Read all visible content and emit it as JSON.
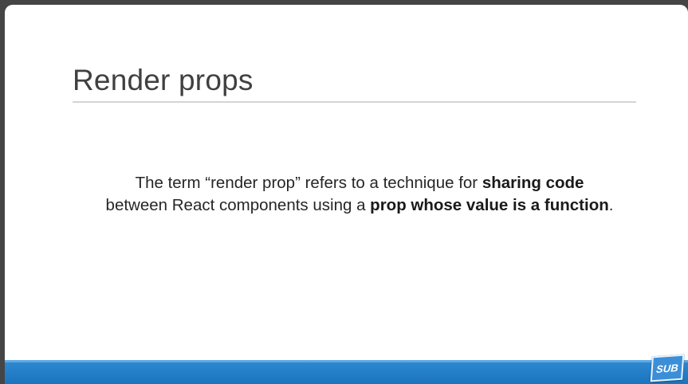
{
  "slide": {
    "title": "Render props",
    "body": {
      "part1": "The term “render prop” refers to a technique for ",
      "bold1": "sharing code",
      "part2": "between React components using a ",
      "bold2": "prop whose value is a function",
      "part3": "."
    }
  },
  "badge": {
    "label": "SUB"
  },
  "colors": {
    "band": "#1b74bd",
    "title": "#404040",
    "background": "#ffffff"
  }
}
